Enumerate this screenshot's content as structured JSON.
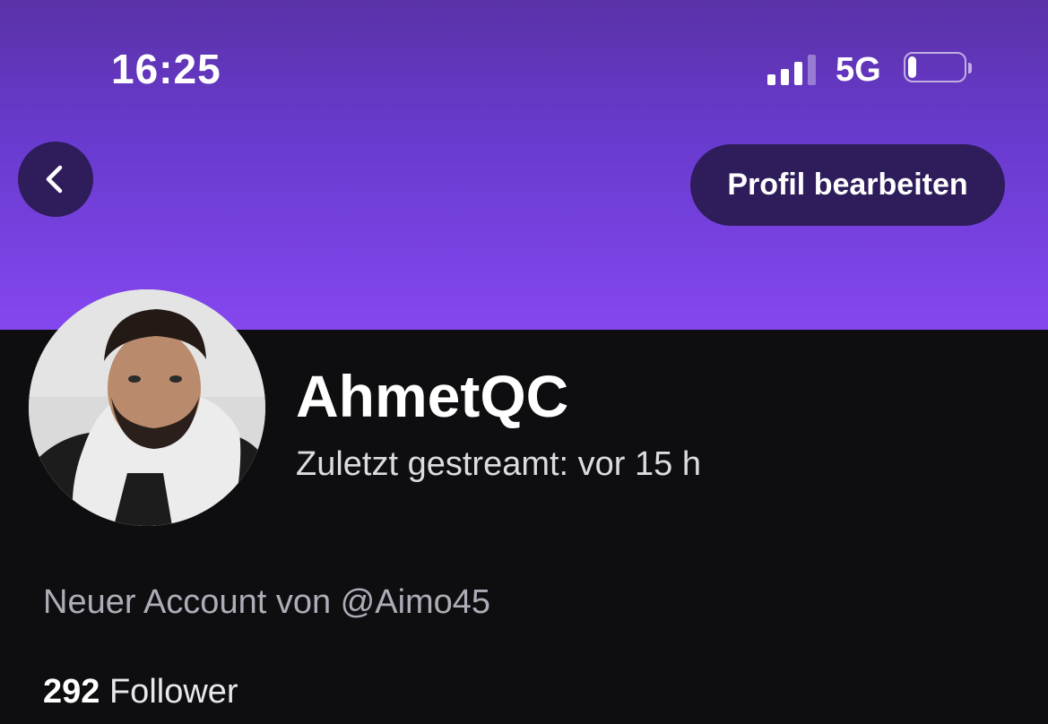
{
  "status_bar": {
    "time": "16:25",
    "network": "5G",
    "signal_icon": "signal-bars-icon",
    "signal_bars_active": 3,
    "signal_bars_total": 4,
    "battery_icon": "battery-icon",
    "battery_level": 0.15
  },
  "header": {
    "back_icon": "chevron-left-icon",
    "edit_profile_label": "Profil bearbeiten",
    "banner_color_top": "#5a32a8",
    "banner_color_bottom": "#8447ef",
    "button_color": "#2e1d5a"
  },
  "profile": {
    "username": "AhmetQC",
    "last_streamed": "Zuletzt gestreamt: vor 15 h",
    "bio": "Neuer Account von @Aimo45",
    "followers_count": "292",
    "followers_label": "Follower"
  },
  "colors": {
    "background": "#0e0e10",
    "accent": "#8447ef"
  }
}
